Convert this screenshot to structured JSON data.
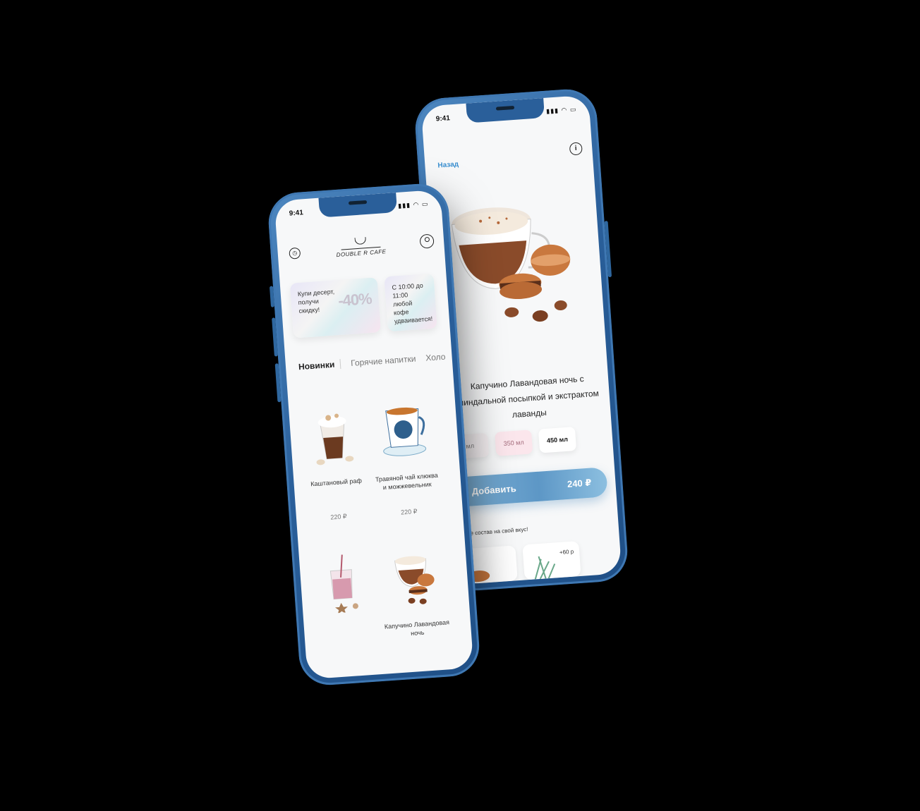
{
  "back_screen": {
    "status_time": "9:41",
    "back_label": "Назад",
    "product_title": "Капучино Лавандовая ночь с миндальной посыпкой и экстрактом лаванды",
    "sizes": [
      {
        "label": "мл"
      },
      {
        "label": "350 мл"
      },
      {
        "label": "450 мл"
      }
    ],
    "add_label": "Добавить",
    "price": "240 ₽",
    "compose_text": "те состав на свой вкус!",
    "addon_price": "+60 р"
  },
  "front_screen": {
    "status_time": "9:41",
    "logo_text": "DOUBLE R CAFE",
    "promos": [
      {
        "text": "Купи десерт, получи скидку!",
        "discount": "-40%"
      },
      {
        "text": "С 10:00 до 11:00 любой кофе удваивается!"
      }
    ],
    "tabs": [
      "Новинки",
      "Горячие напитки",
      "Холо"
    ],
    "products": [
      {
        "name": "Каштановый раф",
        "price": "220 ₽"
      },
      {
        "name": "Травяной чай клюква и можжевельник",
        "price": "220 ₽"
      },
      {
        "name": "",
        "price": ""
      },
      {
        "name": "Капучино Лавандовая ночь",
        "price": ""
      }
    ]
  },
  "colors": {
    "device_blue": "#2a5f9a",
    "accent_blue": "#3a8fd0",
    "button_gradient_start": "#7fb2d6",
    "background": "#000000"
  }
}
